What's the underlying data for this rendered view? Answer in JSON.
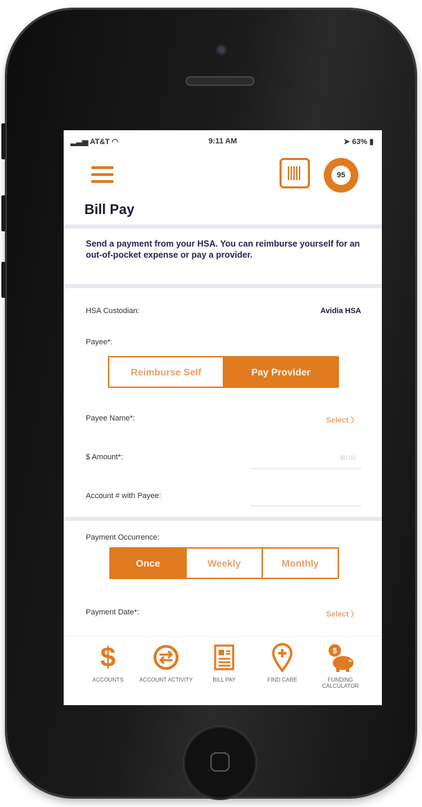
{
  "status_bar": {
    "carrier": "AT&T",
    "time": "9:11 AM",
    "battery": "63%"
  },
  "header": {
    "score": "95",
    "title": "Bill Pay"
  },
  "banner": {
    "text": "Send a payment from your HSA. You can reimburse yourself for an out-of-pocket expense or pay a provider."
  },
  "form": {
    "custodian_label": "HSA Custodian:",
    "custodian_value": "Avidia HSA",
    "payee_label": "Payee*:",
    "payee_options": [
      "Reimburse Self",
      "Pay Provider"
    ],
    "payee_selected": "Pay Provider",
    "payee_name_label": "Payee Name*:",
    "payee_name_action": "Select",
    "amount_label": "$ Amount*:",
    "amount_placeholder": "$0.00",
    "account_label": "Account # with Payee:",
    "occurrence_label": "Payment Occurrence:",
    "occurrence_options": [
      "Once",
      "Weekly",
      "Monthly"
    ],
    "occurrence_selected": "Once",
    "date_label": "Payment Date*:",
    "date_action": "Select"
  },
  "tabbar": {
    "items": [
      {
        "label": "Accounts",
        "icon": "dollar-icon"
      },
      {
        "label": "Account Activity",
        "icon": "exchange-icon"
      },
      {
        "label": "Bill Pay",
        "icon": "bill-icon"
      },
      {
        "label": "Find Care",
        "icon": "location-pin-icon"
      },
      {
        "label": "Funding Calculator",
        "icon": "piggy-bank-icon"
      }
    ]
  },
  "colors": {
    "accent": "#e07b20",
    "title_text": "#1f1a33",
    "banner_text": "#2b2355"
  }
}
